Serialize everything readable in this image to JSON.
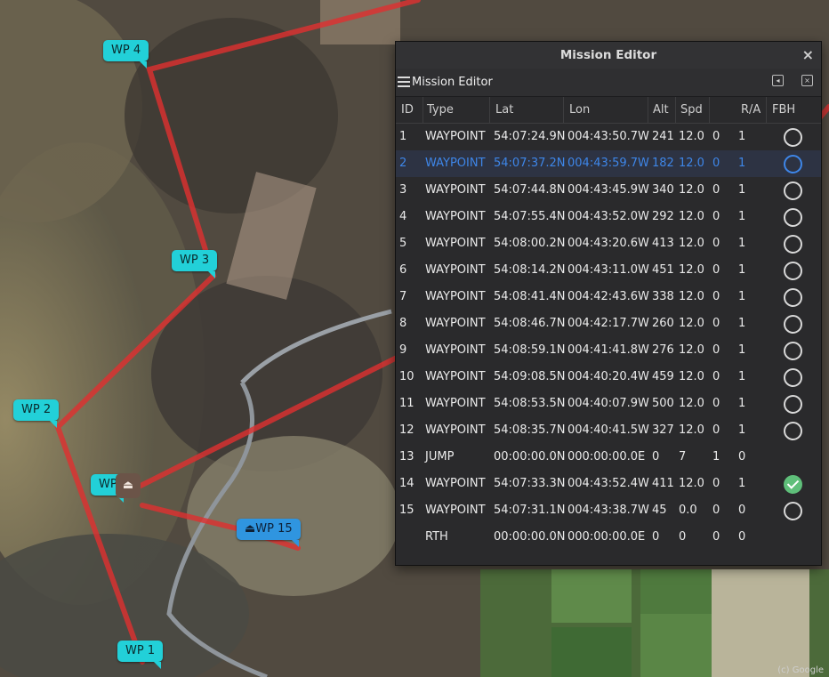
{
  "map": {
    "labels": [
      {
        "text": "WP 4"
      },
      {
        "text": "WP 3"
      },
      {
        "text": "WP 2"
      },
      {
        "text": "WP 1"
      },
      {
        "text": "WP"
      },
      {
        "text": "WP 15"
      }
    ],
    "home_icon": "home-icon",
    "credit": "(c) Google",
    "route_color": "#e03030",
    "label_color": "#22d0d8",
    "label_color_selected": "#2f95e0"
  },
  "editor": {
    "window_title": "Mission Editor",
    "toolbar_title": "Mission Editor",
    "icons": {
      "close": "close-icon",
      "menu": "menu-icon",
      "undock": "undock-icon",
      "dock_close": "dock-close-icon"
    },
    "columns": [
      "ID",
      "Type",
      "Lat",
      "Lon",
      "Alt",
      "Spd",
      "",
      "R/A",
      "FBH"
    ],
    "rows": [
      {
        "id": "1",
        "type": "WAYPOINT",
        "lat": "54:07:24.9N",
        "lon": "004:43:50.7W",
        "alt": "241",
        "spd": "12.0",
        "p3": "0",
        "ra": "1",
        "fbh": "unchecked"
      },
      {
        "id": "2",
        "type": "WAYPOINT",
        "lat": "54:07:37.2N",
        "lon": "004:43:59.7W",
        "alt": "182",
        "spd": "12.0",
        "p3": "0",
        "ra": "1",
        "fbh": "unchecked",
        "selected": true
      },
      {
        "id": "3",
        "type": "WAYPOINT",
        "lat": "54:07:44.8N",
        "lon": "004:43:45.9W",
        "alt": "340",
        "spd": "12.0",
        "p3": "0",
        "ra": "1",
        "fbh": "unchecked"
      },
      {
        "id": "4",
        "type": "WAYPOINT",
        "lat": "54:07:55.4N",
        "lon": "004:43:52.0W",
        "alt": "292",
        "spd": "12.0",
        "p3": "0",
        "ra": "1",
        "fbh": "unchecked"
      },
      {
        "id": "5",
        "type": "WAYPOINT",
        "lat": "54:08:00.2N",
        "lon": "004:43:20.6W",
        "alt": "413",
        "spd": "12.0",
        "p3": "0",
        "ra": "1",
        "fbh": "unchecked"
      },
      {
        "id": "6",
        "type": "WAYPOINT",
        "lat": "54:08:14.2N",
        "lon": "004:43:11.0W",
        "alt": "451",
        "spd": "12.0",
        "p3": "0",
        "ra": "1",
        "fbh": "unchecked"
      },
      {
        "id": "7",
        "type": "WAYPOINT",
        "lat": "54:08:41.4N",
        "lon": "004:42:43.6W",
        "alt": "338",
        "spd": "12.0",
        "p3": "0",
        "ra": "1",
        "fbh": "unchecked"
      },
      {
        "id": "8",
        "type": "WAYPOINT",
        "lat": "54:08:46.7N",
        "lon": "004:42:17.7W",
        "alt": "260",
        "spd": "12.0",
        "p3": "0",
        "ra": "1",
        "fbh": "unchecked"
      },
      {
        "id": "9",
        "type": "WAYPOINT",
        "lat": "54:08:59.1N",
        "lon": "004:41:41.8W",
        "alt": "276",
        "spd": "12.0",
        "p3": "0",
        "ra": "1",
        "fbh": "unchecked"
      },
      {
        "id": "10",
        "type": "WAYPOINT",
        "lat": "54:09:08.5N",
        "lon": "004:40:20.4W",
        "alt": "459",
        "spd": "12.0",
        "p3": "0",
        "ra": "1",
        "fbh": "unchecked"
      },
      {
        "id": "11",
        "type": "WAYPOINT",
        "lat": "54:08:53.5N",
        "lon": "004:40:07.9W",
        "alt": "500",
        "spd": "12.0",
        "p3": "0",
        "ra": "1",
        "fbh": "unchecked"
      },
      {
        "id": "12",
        "type": "WAYPOINT",
        "lat": "54:08:35.7N",
        "lon": "004:40:41.5W",
        "alt": "327",
        "spd": "12.0",
        "p3": "0",
        "ra": "1",
        "fbh": "unchecked"
      },
      {
        "id": "13",
        "type": "JUMP",
        "lat": "00:00:00.0N",
        "lon": "000:00:00.0E",
        "alt": "0",
        "spd": "7",
        "p3": "1",
        "ra": "0",
        "fbh": "none"
      },
      {
        "id": "14",
        "type": "WAYPOINT",
        "lat": "54:07:33.3N",
        "lon": "004:43:52.4W",
        "alt": "411",
        "spd": "12.0",
        "p3": "0",
        "ra": "1",
        "fbh": "checked"
      },
      {
        "id": "15",
        "type": "WAYPOINT",
        "lat": "54:07:31.1N",
        "lon": "004:43:38.7W",
        "alt": "45",
        "spd": "0.0",
        "p3": "0",
        "ra": "0",
        "fbh": "unchecked"
      },
      {
        "id": "",
        "type": "RTH",
        "lat": "00:00:00.0N",
        "lon": "000:00:00.0E",
        "alt": "0",
        "spd": "0",
        "p3": "0",
        "ra": "0",
        "fbh": "none"
      }
    ]
  }
}
